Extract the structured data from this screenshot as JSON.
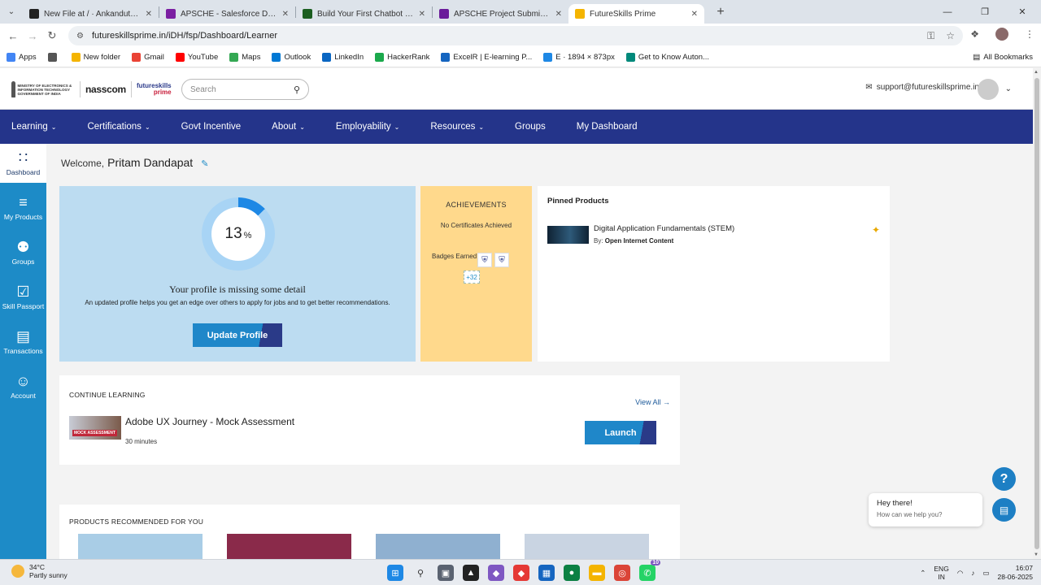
{
  "browser": {
    "tabs": [
      {
        "title": "New File at / · Ankandutt/Garag",
        "favicon_color": "#222222",
        "active": false
      },
      {
        "title": "APSCHE - Salesforce Devel",
        "favicon_color": "#7b1fa2",
        "active": false
      },
      {
        "title": "Build Your First Chatbot | Skillsh",
        "favicon_color": "#1b5e20",
        "active": false
      },
      {
        "title": "APSCHE Project Submission For",
        "favicon_color": "#6a1b9a",
        "active": false
      },
      {
        "title": "FutureSkills Prime",
        "favicon_color": "#f4b400",
        "active": true
      }
    ],
    "url": "futureskillsprime.in/iDH/fsp/Dashboard/Learner",
    "bookmarks": [
      {
        "label": "Apps",
        "color": "#4285f4"
      },
      {
        "label": "",
        "color": "#555555"
      },
      {
        "label": "New folder",
        "color": "#f4b400"
      },
      {
        "label": "Gmail",
        "color": "#ea4335"
      },
      {
        "label": "YouTube",
        "color": "#ff0000"
      },
      {
        "label": "Maps",
        "color": "#34a853"
      },
      {
        "label": "Outlook",
        "color": "#0078d4"
      },
      {
        "label": "LinkedIn",
        "color": "#0a66c2"
      },
      {
        "label": "HackerRank",
        "color": "#1ba94c"
      },
      {
        "label": "ExcelR | E-learning P...",
        "color": "#1565c0"
      },
      {
        "label": "E · 1894 × 873px",
        "color": "#1e88e5"
      },
      {
        "label": "Get to Know Auton...",
        "color": "#00897b"
      }
    ],
    "all_bookmarks": "All Bookmarks"
  },
  "site": {
    "gov_logo_text": "MINISTRY OF ELECTRONICS & INFORMATION TECHNOLOGY GOVERNMENT OF INDIA",
    "nasscom": "nasscom",
    "fsp_logo_top": "futureskills",
    "fsp_logo_bottom": "prime",
    "search_placeholder": "Search",
    "support_email": "support@futureskillsprime.in"
  },
  "nav": [
    {
      "label": "Learning",
      "dropdown": true
    },
    {
      "label": "Certifications",
      "dropdown": true
    },
    {
      "label": "Govt Incentive",
      "dropdown": false
    },
    {
      "label": "About",
      "dropdown": true
    },
    {
      "label": "Employability",
      "dropdown": true
    },
    {
      "label": "Resources",
      "dropdown": true
    },
    {
      "label": "Groups",
      "dropdown": false
    },
    {
      "label": "My Dashboard",
      "dropdown": false
    }
  ],
  "sidebar": [
    {
      "label": "Dashboard",
      "icon": "dashboard-icon",
      "active": true
    },
    {
      "label": "My Products",
      "icon": "layers-icon",
      "active": false
    },
    {
      "label": "Groups",
      "icon": "groups-icon",
      "active": false
    },
    {
      "label": "Skill Passport",
      "icon": "passport-icon",
      "active": false
    },
    {
      "label": "Transactions",
      "icon": "transactions-icon",
      "active": false
    },
    {
      "label": "Account",
      "icon": "account-icon",
      "active": false
    }
  ],
  "welcome": {
    "prefix": "Welcome,",
    "name": "Pritam Dandapat"
  },
  "profile": {
    "completion_percent": 13,
    "percent_sign": "%",
    "title": "Your profile is missing some detail",
    "subtitle": "An updated profile helps you get an edge over others to apply for jobs and to get better recommendations.",
    "button": "Update Profile"
  },
  "achievements": {
    "title": "ACHIEVEMENTS",
    "certificates": "No Certificates Achieved",
    "badges_label": "Badges Earned",
    "more_badges": "+32"
  },
  "pinned": {
    "title": "Pinned Products",
    "product_name": "Digital Application Fundamentals (STEM)",
    "by_label": "By:",
    "provider": "Open Internet Content"
  },
  "continue_learning": {
    "title": "CONTINUE LEARNING",
    "view_all": "View All",
    "course_name": "Adobe UX Journey - Mock Assessment",
    "duration": "30 minutes",
    "thumb_tag": "MOCK ASSESSMENT",
    "button": "Launch"
  },
  "recommended": {
    "title": "PRODUCTS RECOMMENDED FOR YOU",
    "thumb_colors": [
      "#a9cde6",
      "#8a2a4a",
      "#8fb0d0",
      "#c9d4e2"
    ]
  },
  "chat": {
    "help_glyph": "?",
    "greeting": "Hey there!",
    "prompt": "How can we help you?"
  },
  "taskbar": {
    "temperature": "34°C",
    "weather": "Partly sunny",
    "lang_top": "ENG",
    "lang_bottom": "IN",
    "time": "16:07",
    "date": "28-06-2025",
    "whatsapp_badge": "10"
  },
  "colors": {
    "nav_bg": "#24348a",
    "sidebar_bg": "#1d8bc7",
    "profile_card_bg": "#bcdcf1",
    "achievements_bg": "#ffd98c",
    "progress": "#1e88e5"
  }
}
